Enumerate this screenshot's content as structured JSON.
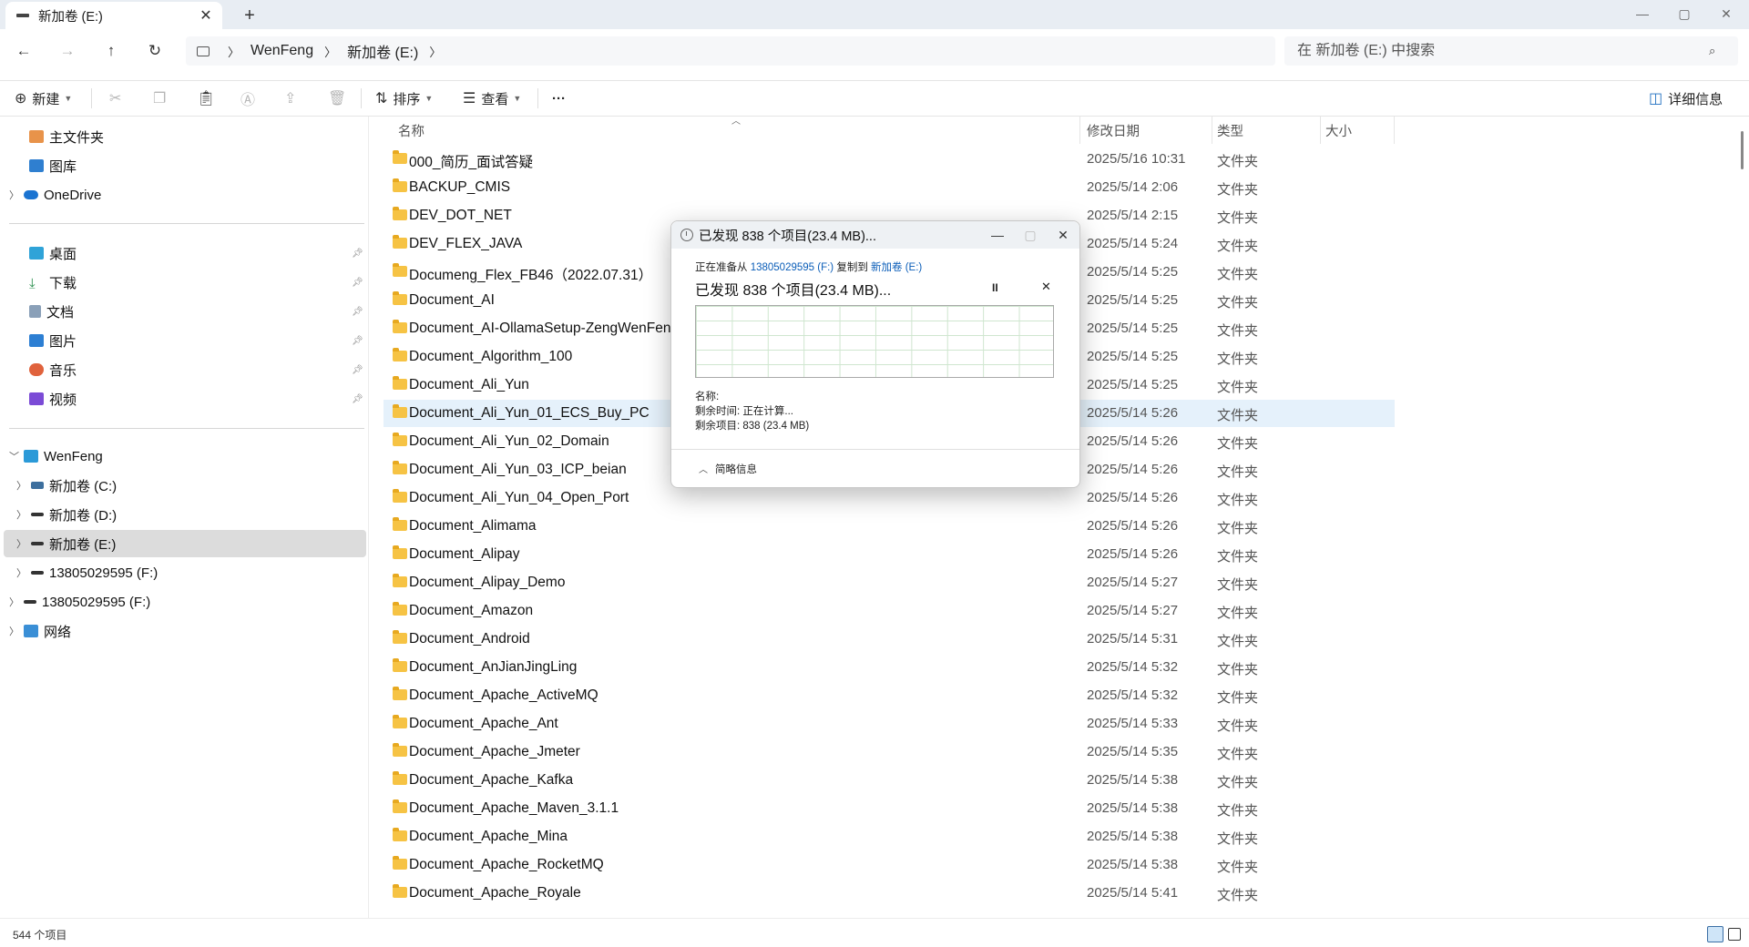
{
  "tab": {
    "title": "新加卷 (E:)",
    "close": "✕",
    "add": "+"
  },
  "window": {
    "minimize": "—",
    "maximize": "▢",
    "close": "✕"
  },
  "address": {
    "crumbs": [
      "WenFeng",
      "新加卷 (E:)"
    ],
    "search_placeholder": "在 新加卷 (E:) 中搜索"
  },
  "toolbar": {
    "new_label": "新建",
    "sort_label": "排序",
    "view_label": "查看",
    "more_label": "···",
    "details_label": "详细信息"
  },
  "sidebar": {
    "home": "主文件夹",
    "gallery": "图库",
    "onedrive": "OneDrive",
    "quick": [
      "桌面",
      "下载",
      "文档",
      "图片",
      "音乐",
      "视频"
    ],
    "this_pc": "WenFeng",
    "drives": [
      "新加卷 (C:)",
      "新加卷 (D:)",
      "新加卷 (E:)",
      "13805029595 (F:)"
    ],
    "removable": "13805029595 (F:)",
    "network": "网络"
  },
  "columns": {
    "name": "名称",
    "date": "修改日期",
    "type": "类型",
    "size": "大小"
  },
  "files": [
    {
      "name": "000_简历_面试答疑",
      "date": "2025/5/16 10:31",
      "type": "文件夹"
    },
    {
      "name": "BACKUP_CMIS",
      "date": "2025/5/14 2:06",
      "type": "文件夹"
    },
    {
      "name": "DEV_DOT_NET",
      "date": "2025/5/14 2:15",
      "type": "文件夹"
    },
    {
      "name": "DEV_FLEX_JAVA",
      "date": "2025/5/14 5:24",
      "type": "文件夹"
    },
    {
      "name": "Documeng_Flex_FB46（2022.07.31）",
      "date": "2025/5/14 5:25",
      "type": "文件夹"
    },
    {
      "name": "Document_AI",
      "date": "2025/5/14 5:25",
      "type": "文件夹"
    },
    {
      "name": "Document_AI-OllamaSetup-ZengWenFeng",
      "date": "2025/5/14 5:25",
      "type": "文件夹"
    },
    {
      "name": "Document_Algorithm_100",
      "date": "2025/5/14 5:25",
      "type": "文件夹"
    },
    {
      "name": "Document_Ali_Yun",
      "date": "2025/5/14 5:25",
      "type": "文件夹"
    },
    {
      "name": "Document_Ali_Yun_01_ECS_Buy_PC",
      "date": "2025/5/14 5:26",
      "type": "文件夹"
    },
    {
      "name": "Document_Ali_Yun_02_Domain",
      "date": "2025/5/14 5:26",
      "type": "文件夹"
    },
    {
      "name": "Document_Ali_Yun_03_ICP_beian",
      "date": "2025/5/14 5:26",
      "type": "文件夹"
    },
    {
      "name": "Document_Ali_Yun_04_Open_Port",
      "date": "2025/5/14 5:26",
      "type": "文件夹"
    },
    {
      "name": "Document_Alimama",
      "date": "2025/5/14 5:26",
      "type": "文件夹"
    },
    {
      "name": "Document_Alipay",
      "date": "2025/5/14 5:26",
      "type": "文件夹"
    },
    {
      "name": "Document_Alipay_Demo",
      "date": "2025/5/14 5:27",
      "type": "文件夹"
    },
    {
      "name": "Document_Amazon",
      "date": "2025/5/14 5:27",
      "type": "文件夹"
    },
    {
      "name": "Document_Android",
      "date": "2025/5/14 5:31",
      "type": "文件夹"
    },
    {
      "name": "Document_AnJianJingLing",
      "date": "2025/5/14 5:32",
      "type": "文件夹"
    },
    {
      "name": "Document_Apache_ActiveMQ",
      "date": "2025/5/14 5:32",
      "type": "文件夹"
    },
    {
      "name": "Document_Apache_Ant",
      "date": "2025/5/14 5:33",
      "type": "文件夹"
    },
    {
      "name": "Document_Apache_Jmeter",
      "date": "2025/5/14 5:35",
      "type": "文件夹"
    },
    {
      "name": "Document_Apache_Kafka",
      "date": "2025/5/14 5:38",
      "type": "文件夹"
    },
    {
      "name": "Document_Apache_Maven_3.1.1",
      "date": "2025/5/14 5:38",
      "type": "文件夹"
    },
    {
      "name": "Document_Apache_Mina",
      "date": "2025/5/14 5:38",
      "type": "文件夹"
    },
    {
      "name": "Document_Apache_RocketMQ",
      "date": "2025/5/14 5:38",
      "type": "文件夹"
    },
    {
      "name": "Document_Apache_Royale",
      "date": "2025/5/14 5:41",
      "type": "文件夹"
    }
  ],
  "selected_file": "Document_Ali_Yun_01_ECS_Buy_PC",
  "status": {
    "count": "544 个项目"
  },
  "dialog": {
    "title": "已发现 838 个项目(23.4 MB)...",
    "from_prefix": "正在准备从 ",
    "from_source": "13805029595 (F:)",
    "from_middle": " 复制到 ",
    "from_dest": "新加卷 (E:)",
    "heading": "已发现 838 个项目(23.4 MB)...",
    "pause": "II",
    "cancel": "✕",
    "name_label": "名称:",
    "time_left": "剩余时间: 正在计算...",
    "items_left": "剩余项目: 838 (23.4 MB)",
    "less_details": "简略信息"
  }
}
